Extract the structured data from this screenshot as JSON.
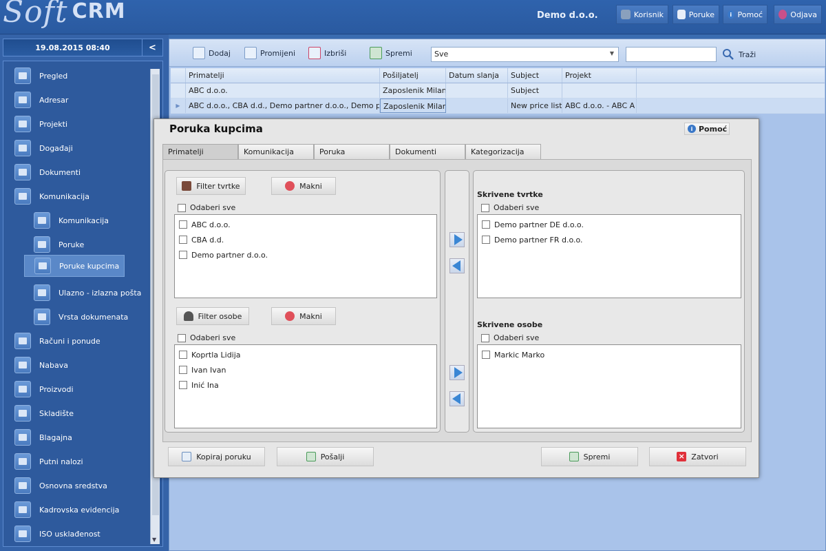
{
  "app": {
    "logo_soft": "Soft",
    "logo_crm": "CRM",
    "company": "Demo d.o.o."
  },
  "header_buttons": [
    {
      "label": "Korisnik",
      "icon": "user-icon"
    },
    {
      "label": "Poruke",
      "icon": "message-icon"
    },
    {
      "label": "Pomoć",
      "icon": "info-icon"
    },
    {
      "label": "Odjava",
      "icon": "power-icon"
    }
  ],
  "sidebar": {
    "datetime": "19.08.2015 08:40",
    "collapse": "<",
    "items": [
      {
        "label": "Pregled"
      },
      {
        "label": "Adresar"
      },
      {
        "label": "Projekti"
      },
      {
        "label": "Događaji"
      },
      {
        "label": "Dokumenti"
      },
      {
        "label": "Komunikacija"
      },
      {
        "label": "Komunikacija"
      },
      {
        "label": "Poruke"
      },
      {
        "label": "Poruke kupcima"
      },
      {
        "label": "Ulazno - izlazna pošta"
      },
      {
        "label": "Vrsta dokumenata"
      },
      {
        "label": "Računi i ponude"
      },
      {
        "label": "Nabava"
      },
      {
        "label": "Proizvodi"
      },
      {
        "label": "Skladište"
      },
      {
        "label": "Blagajna"
      },
      {
        "label": "Putni nalozi"
      },
      {
        "label": "Osnovna sredstva"
      },
      {
        "label": "Kadrovska evidencija"
      },
      {
        "label": "ISO usklađenost"
      }
    ]
  },
  "toolbar": {
    "add": "Dodaj",
    "edit": "Promijeni",
    "delete": "Izbriši",
    "save": "Spremi",
    "filter_value": "Sve",
    "search_value": "",
    "search_button": "Traži"
  },
  "grid": {
    "columns": [
      "Primatelji",
      "Pošiljatelj",
      "Datum slanja",
      "Subject",
      "Projekt"
    ],
    "rows": [
      [
        "ABC d.o.o.",
        "Zaposlenik Milan",
        "",
        "Subject",
        ""
      ],
      [
        "ABC d.o.o., CBA d.d., Demo partner d.o.o., Demo partner DE d.o.o.",
        "Zaposlenik Milan",
        "",
        "New price list",
        "ABC d.o.o. - ABC A"
      ]
    ]
  },
  "modal": {
    "title": "Poruka kupcima",
    "help": "Pomoć",
    "tabs": [
      "Primatelji",
      "Komunikacija",
      "Poruka",
      "Dokumenti",
      "Kategorizacija"
    ],
    "filter_companies": "Filter tvrtke",
    "remove": "Makni",
    "filter_persons": "Filter osobe",
    "select_all": "Odaberi sve",
    "companies": [
      "ABC d.o.o.",
      "CBA d.d.",
      "Demo partner d.o.o."
    ],
    "persons": [
      "Koprtla Lidija",
      "Ivan Ivan",
      "Inić Ina"
    ],
    "hidden_companies_title": "Skrivene tvrtke",
    "hidden_companies": [
      "Demo partner DE d.o.o.",
      "Demo partner FR d.o.o."
    ],
    "hidden_persons_title": "Skrivene osobe",
    "hidden_persons": [
      "Markic Marko"
    ],
    "copy_message": "Kopiraj poruku",
    "send": "Pošalji",
    "save": "Spremi",
    "close": "Zatvori"
  }
}
